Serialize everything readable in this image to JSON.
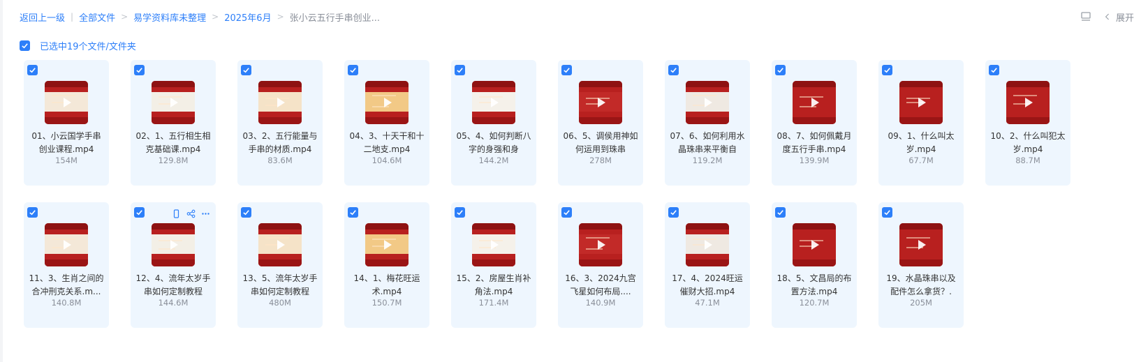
{
  "breadcrumb": {
    "back": "返回上一级",
    "items": [
      "全部文件",
      "易学资料库未整理",
      "2025年6月"
    ],
    "current": "张小云五行手串创业..."
  },
  "toolbar": {
    "expand_label": "展开"
  },
  "selection": {
    "label": "已选中19个文件/文件夹"
  },
  "files": [
    {
      "name": "01、小云国学手串创业课程.mp4",
      "size": "154M"
    },
    {
      "name": "02、1、五行相生相克基础课.mp4",
      "size": "129.8M"
    },
    {
      "name": "03、2、五行能量与手串的材质.mp4",
      "size": "83.6M"
    },
    {
      "name": "04、3、十天干和十二地支.mp4",
      "size": "104.6M"
    },
    {
      "name": "05、4、如何判断八字的身强和身",
      "size": "144.2M"
    },
    {
      "name": "06、5、调侯用神如何运用到珠串",
      "size": "278M"
    },
    {
      "name": "07、6、如何利用水晶珠串来平衡自",
      "size": "119.2M"
    },
    {
      "name": "08、7、如何佩戴月度五行手串.mp4",
      "size": "139.9M"
    },
    {
      "name": "09、1、什么叫太岁.mp4",
      "size": "67.7M"
    },
    {
      "name": "10、2、什么叫犯太岁.mp4",
      "size": "88.7M"
    },
    {
      "name": "11、3、生肖之间的合冲刑克关系.m...",
      "size": "140.8M"
    },
    {
      "name": "12、4、流年太岁手串如何定制教程",
      "size": "144.6M"
    },
    {
      "name": "13、5、流年太岁手串如何定制教程",
      "size": "480M"
    },
    {
      "name": "14、1、梅花旺运术.mp4",
      "size": "150.7M"
    },
    {
      "name": "15、2、房屋生肖补角法.mp4",
      "size": "171.4M"
    },
    {
      "name": "16、3、2024九宫飞星如何布局....",
      "size": "140.9M"
    },
    {
      "name": "17、4、2024旺运催财大招.mp4",
      "size": "47.1M"
    },
    {
      "name": "18、5、文昌局的布置方法.mp4",
      "size": "120.7M"
    },
    {
      "name": "19、水晶珠串以及配件怎么拿货？.",
      "size": "205M"
    }
  ],
  "colors": {
    "accent": "#2d7ff9",
    "card_bg": "#eef6fe",
    "thumb_red": "#b8201f"
  },
  "icons": [
    "check-icon",
    "list-view-icon",
    "chevron-left-icon",
    "play-icon",
    "phone-icon",
    "share-icon",
    "more-icon"
  ]
}
